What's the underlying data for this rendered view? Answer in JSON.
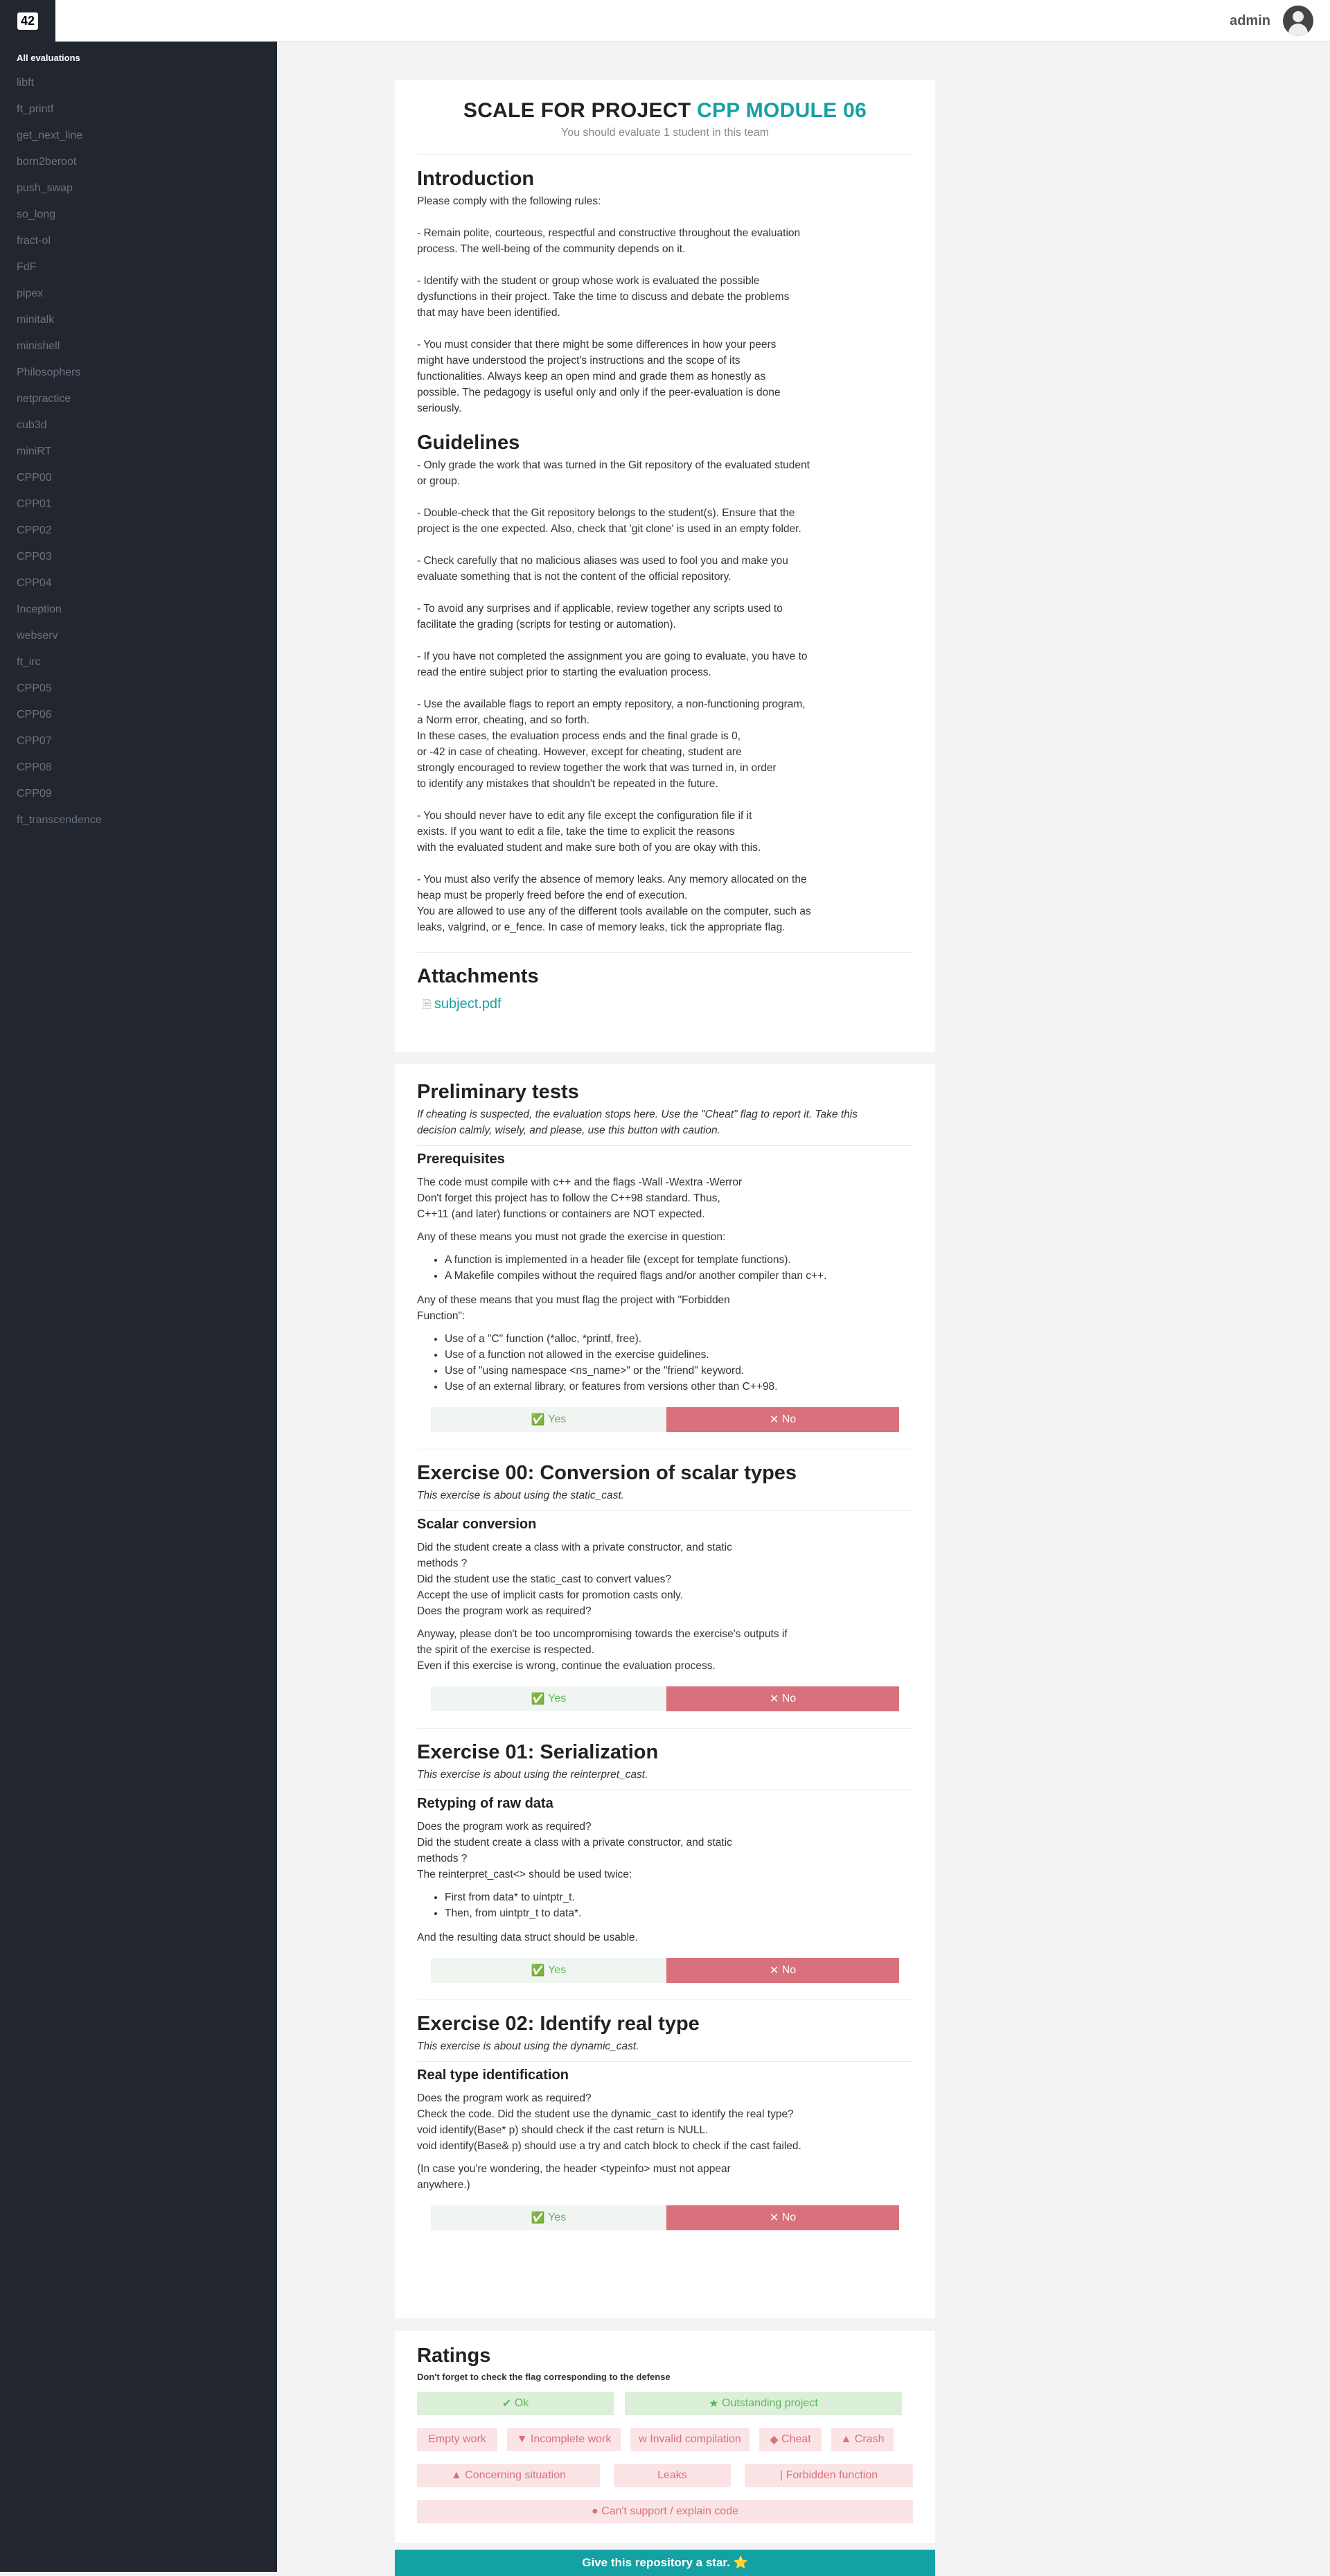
{
  "app": {
    "logo": "42",
    "username": "admin"
  },
  "sidebar": {
    "heading": "All evaluations",
    "items": [
      "libft",
      "ft_printf",
      "get_next_line",
      "born2beroot",
      "push_swap",
      "so_long",
      "fract-ol",
      "FdF",
      "pipex",
      "minitalk",
      "minishell",
      "Philosophers",
      "netpractice",
      "cub3d",
      "miniRT",
      "CPP00",
      "CPP01",
      "CPP02",
      "CPP03",
      "CPP04",
      "Inception",
      "webserv",
      "ft_irc",
      "CPP05",
      "CPP06",
      "CPP07",
      "CPP08",
      "CPP09",
      "ft_transcendence"
    ]
  },
  "header": {
    "title_prefix": "SCALE FOR PROJECT",
    "project": "CPP MODULE 06",
    "subtitle": "You should evaluate 1 student in this team"
  },
  "intro": {
    "title": "Introduction",
    "text": "Please comply with the following rules:\n\n- Remain polite, courteous, respectful and constructive throughout the evaluation process. The well-being of the community depends on it.\n\n- Identify with the student or group whose work is evaluated the possible dysfunctions in their project. Take the time to discuss and debate the problems that may have been identified.\n\n- You must consider that there might be some differences in how your peers might have understood the project's instructions and the scope of its functionalities. Always keep an open mind and grade them as honestly as possible. The pedagogy is useful only and only if the peer-evaluation is done seriously."
  },
  "guidelines": {
    "title": "Guidelines",
    "text": "- Only grade the work that was turned in the Git repository of the evaluated student or group.\n\n- Double-check that the Git repository belongs to the student(s). Ensure that the project is the one expected. Also, check that 'git clone' is used in an empty folder.\n\n- Check carefully that no malicious aliases was used to fool you and make you evaluate something that is not the content of the official repository.\n\n- To avoid any surprises and if applicable, review together any scripts used to facilitate the grading (scripts for testing or automation).\n\n- If you have not completed the assignment you are going to evaluate, you have to read the entire subject prior to starting the evaluation process.\n\n- Use the available flags to report an empty repository, a non-functioning program, a Norm error, cheating, and so forth.\nIn these cases, the evaluation process ends and the final grade is 0,\nor -42 in case of cheating. However, except for cheating, student are\nstrongly encouraged to review together the work that was turned in, in order\nto identify any mistakes that shouldn't be repeated in the future.\n\n- You should never have to edit any file except the configuration file if it\nexists. If you want to edit a file, take the time to explicit the reasons\nwith the evaluated student and make sure both of you are okay with this.\n\n- You must also verify the absence of memory leaks. Any memory allocated on the heap must be properly freed before the end of execution.\nYou are allowed to use any of the different tools available on the computer, such as leaks, valgrind, or e_fence. In case of memory leaks, tick the appropriate flag."
  },
  "attachments": {
    "title": "Attachments",
    "file": "subject.pdf"
  },
  "preliminary": {
    "title": "Preliminary tests",
    "desc": "If cheating is suspected, the evaluation stops here. Use the \"Cheat\" flag to report it. Take this decision calmly, wisely, and please, use this button with caution.",
    "sub": "Prerequisites",
    "p1": "The code must compile with c++ and the flags -Wall -Wextra -Werror\nDon't forget this project has to follow the C++98 standard. Thus,\nC++11 (and later) functions or containers are NOT expected.",
    "p2": "Any of these means you must not grade the exercise in question:",
    "list1": [
      "A function is implemented in a header file (except for template functions).",
      "A Makefile compiles without the required flags and/or another compiler than c++."
    ],
    "p3": "Any of these means that you must flag the project with \"Forbidden Function\":",
    "list2": [
      "Use of a \"C\" function (*alloc, *printf, free).",
      "Use of a function not allowed in the exercise guidelines.",
      "Use of \"using namespace <ns_name>\" or the \"friend\" keyword.",
      "Use of an external library, or features from versions other than C++98."
    ]
  },
  "ex00": {
    "title": "Exercise 00: Conversion of scalar types",
    "desc": "This exercise is about using the static_cast.",
    "sub": "Scalar conversion",
    "p1": "Did the student create a class with a private constructor, and static methods ?\nDid the student use the static_cast to convert values?\nAccept the use of implicit casts for promotion casts only.\nDoes the program work as required?",
    "p2": "Anyway, please don't be too uncompromising towards the exercise's outputs if the spirit of the exercise is respected.\nEven if this exercise is wrong, continue the evaluation process."
  },
  "ex01": {
    "title": "Exercise 01: Serialization",
    "desc": "This exercise is about using the reinterpret_cast.",
    "sub": "Retyping of raw data",
    "p1": "Does the program work as required?\nDid the student create a class with a private constructor, and static methods ?\nThe reinterpret_cast<> should be used twice:",
    "list": [
      "First from data* to uintptr_t.",
      "Then, from uintptr_t to data*."
    ],
    "p2": "And the resulting data struct should be usable."
  },
  "ex02": {
    "title": "Exercise 02: Identify real type",
    "desc": "This exercise is about using the dynamic_cast.",
    "sub": "Real type identification",
    "p1": "Does the program work as required?\nCheck the code. Did the student use the dynamic_cast to identify the real type?\nvoid identify(Base* p) should check if the cast return is NULL.\nvoid identify(Base& p) should use a try and catch block to check if the cast failed.",
    "p2": "(In case you're wondering, the header <typeinfo> must not appear anywhere.)"
  },
  "buttons": {
    "yes": "Yes",
    "no": "No",
    "yes_icon": "✅",
    "no_icon": "✕"
  },
  "ratings": {
    "title": "Ratings",
    "note": "Don't forget to check the flag corresponding to the defense",
    "ok": "Ok",
    "outstanding": "Outstanding project",
    "empty": "Empty work",
    "incomplete": "Incomplete work",
    "invalid": "Invalid compilation",
    "cheat": "Cheat",
    "crash": "Crash",
    "concerning": "Concerning situation",
    "leaks": "Leaks",
    "forbidden": "Forbidden function",
    "cant_support": "Can't support / explain code",
    "colors": {
      "ok": "#5cb85c",
      "bad": "#d9717d",
      "accent": "#18a0a3"
    }
  },
  "footer": {
    "star": "Give this repository a star. ⭐"
  }
}
